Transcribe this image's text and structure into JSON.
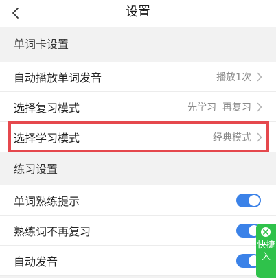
{
  "header": {
    "title": "设置",
    "back_icon": "chevron-left-icon"
  },
  "sections": [
    {
      "title": "单词卡设置",
      "items": [
        {
          "label": "自动播放单词发音",
          "value": "播放1次"
        },
        {
          "label": "选择复习模式",
          "value": "先学习  再复习"
        },
        {
          "label": "选择学习模式",
          "value": "经典模式"
        }
      ]
    },
    {
      "title": "练习设置",
      "items": [
        {
          "label": "单词熟练提示",
          "toggle_on": true
        },
        {
          "label": "熟练词不再复习",
          "toggle_on": true
        },
        {
          "label": "自动发音",
          "toggle_on": true
        }
      ]
    }
  ],
  "floating_tab": {
    "text": "快捷入",
    "close_icon": "close-icon"
  },
  "colors": {
    "toggle_on": "#3b82e8",
    "highlight_border": "#e5484d",
    "floating_tab": "#2fc24b",
    "page_bg": "#f2f2f2"
  }
}
